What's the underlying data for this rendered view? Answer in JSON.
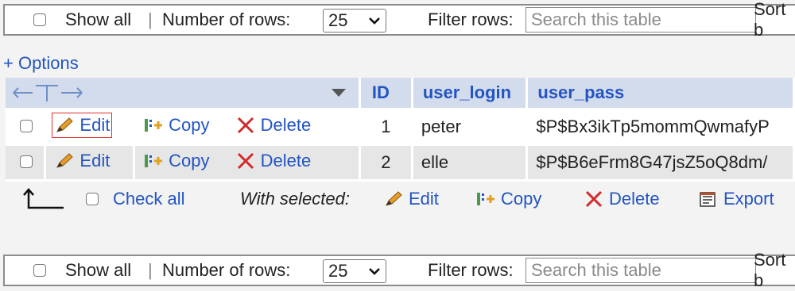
{
  "top_nav": {
    "show_all_label": "Show all",
    "separator": "|",
    "rows_label": "Number of rows:",
    "rows_value": "25",
    "filter_label": "Filter rows:",
    "search_placeholder": "Search this table",
    "sort_label": "Sort b"
  },
  "options_link": "+ Options",
  "table": {
    "columns": [
      "ID",
      "user_login",
      "user_pass"
    ],
    "rows": [
      {
        "id": "1",
        "user_login": "peter",
        "user_pass": "$P$Bx3ikTp5mommQwmafyP"
      },
      {
        "id": "2",
        "user_login": "elle",
        "user_pass": "$P$B6eFrm8G47jsZ5oQ8dm/"
      }
    ],
    "actions": {
      "edit": "Edit",
      "copy": "Copy",
      "delete": "Delete"
    }
  },
  "bulk": {
    "check_all": "Check all",
    "with_selected": "With selected:",
    "edit": "Edit",
    "copy": "Copy",
    "delete": "Delete",
    "export": "Export"
  },
  "bottom_nav": {
    "show_all_label": "Show all",
    "separator": "|",
    "rows_label": "Number of rows:",
    "rows_value": "25",
    "filter_label": "Filter rows:",
    "search_placeholder": "Search this table",
    "sort_label": "Sort b"
  },
  "colors": {
    "link": "#2354c2",
    "header_bg": "#d3dced",
    "delete_red": "#d22b2b",
    "highlight": "#e03030"
  }
}
